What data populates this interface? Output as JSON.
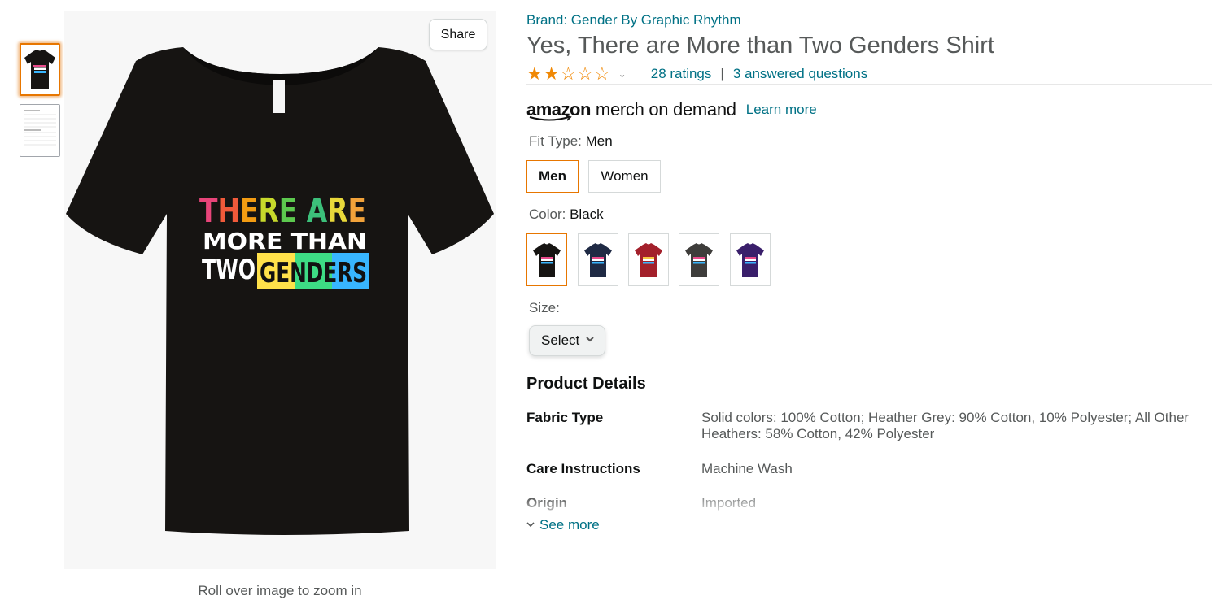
{
  "thumbnails": [
    {
      "label": "main shirt thumbnail",
      "selected": true
    },
    {
      "label": "size chart thumbnail",
      "selected": false
    }
  ],
  "main_image": {
    "share_label": "Share",
    "zoom_hint": "Roll over image to zoom in",
    "shirt_color": "#161412",
    "print_lines": [
      "THERE ARE",
      "MORE THAN",
      "TWO",
      "GENDERS"
    ]
  },
  "product": {
    "brand": "Brand: Gender By Graphic Rhythm",
    "title": "Yes, There are More than Two Genders Shirt",
    "rating": 2,
    "rating_max": 5,
    "ratings_count": "28 ratings",
    "separator": "|",
    "answered_questions": "3 answered questions"
  },
  "merch": {
    "logo_amazon": "amazon",
    "logo_rest": "merch on demand",
    "learn_more": "Learn more"
  },
  "fit_type": {
    "label": "Fit Type:",
    "value": "Men",
    "options": [
      "Men",
      "Women"
    ]
  },
  "color": {
    "label": "Color:",
    "value": "Black",
    "swatches": [
      {
        "name": "Black",
        "hex": "#161412"
      },
      {
        "name": "Navy",
        "hex": "#1f2a44"
      },
      {
        "name": "Cranberry",
        "hex": "#a3202b"
      },
      {
        "name": "Asphalt",
        "hex": "#3e3d3b"
      },
      {
        "name": "Purple",
        "hex": "#3a1f6b"
      }
    ]
  },
  "size": {
    "label": "Size:",
    "select_value": "Select"
  },
  "details": {
    "heading": "Product Details",
    "rows": [
      {
        "key": "Fabric Type",
        "value": "Solid colors: 100% Cotton; Heather Grey: 90% Cotton, 10% Polyester; All Other Heathers: 58% Cotton, 42% Polyester"
      },
      {
        "key": "Care Instructions",
        "value": "Machine Wash"
      },
      {
        "key": "Origin",
        "value": "Imported"
      }
    ],
    "see_more": "See more"
  },
  "colors": {
    "link": "#007185",
    "accent_orange": "#e77600",
    "star": "#f08804"
  }
}
